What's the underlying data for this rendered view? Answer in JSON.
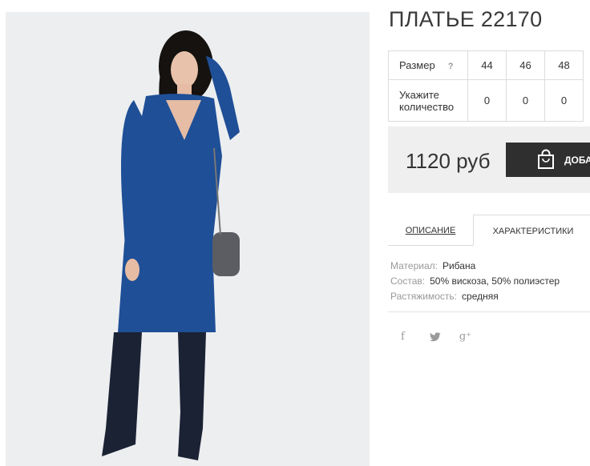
{
  "product": {
    "title": "ПЛАТЬЕ 22170",
    "photo_alt": ""
  },
  "size_table": {
    "size_label": "Размер",
    "help_icon": "?",
    "sizes": [
      "44",
      "46",
      "48"
    ],
    "qty_label_line1": "Укажите",
    "qty_label_line2": "количество",
    "quantities": [
      "0",
      "0",
      "0"
    ]
  },
  "purchase": {
    "price": "1120 руб",
    "add_button_label": "ДОБА",
    "button_color": "#2f2f2f"
  },
  "tabs": {
    "description": "ОПИСАНИЕ",
    "characteristics": "ХАРАКТЕРИСТИКИ",
    "active": "characteristics"
  },
  "specs": [
    {
      "key": "Материал:",
      "value": "Рибана"
    },
    {
      "key": "Состав:",
      "value": "50% вискоза, 50% полиэстер"
    },
    {
      "key": "Растяжимость:",
      "value": "средняя"
    }
  ],
  "social": {
    "facebook": "f",
    "twitter_icon": "twitter-icon",
    "googleplus": "g⁺"
  },
  "colors": {
    "dress": "#1f4f96",
    "boots": "#1b2234"
  }
}
